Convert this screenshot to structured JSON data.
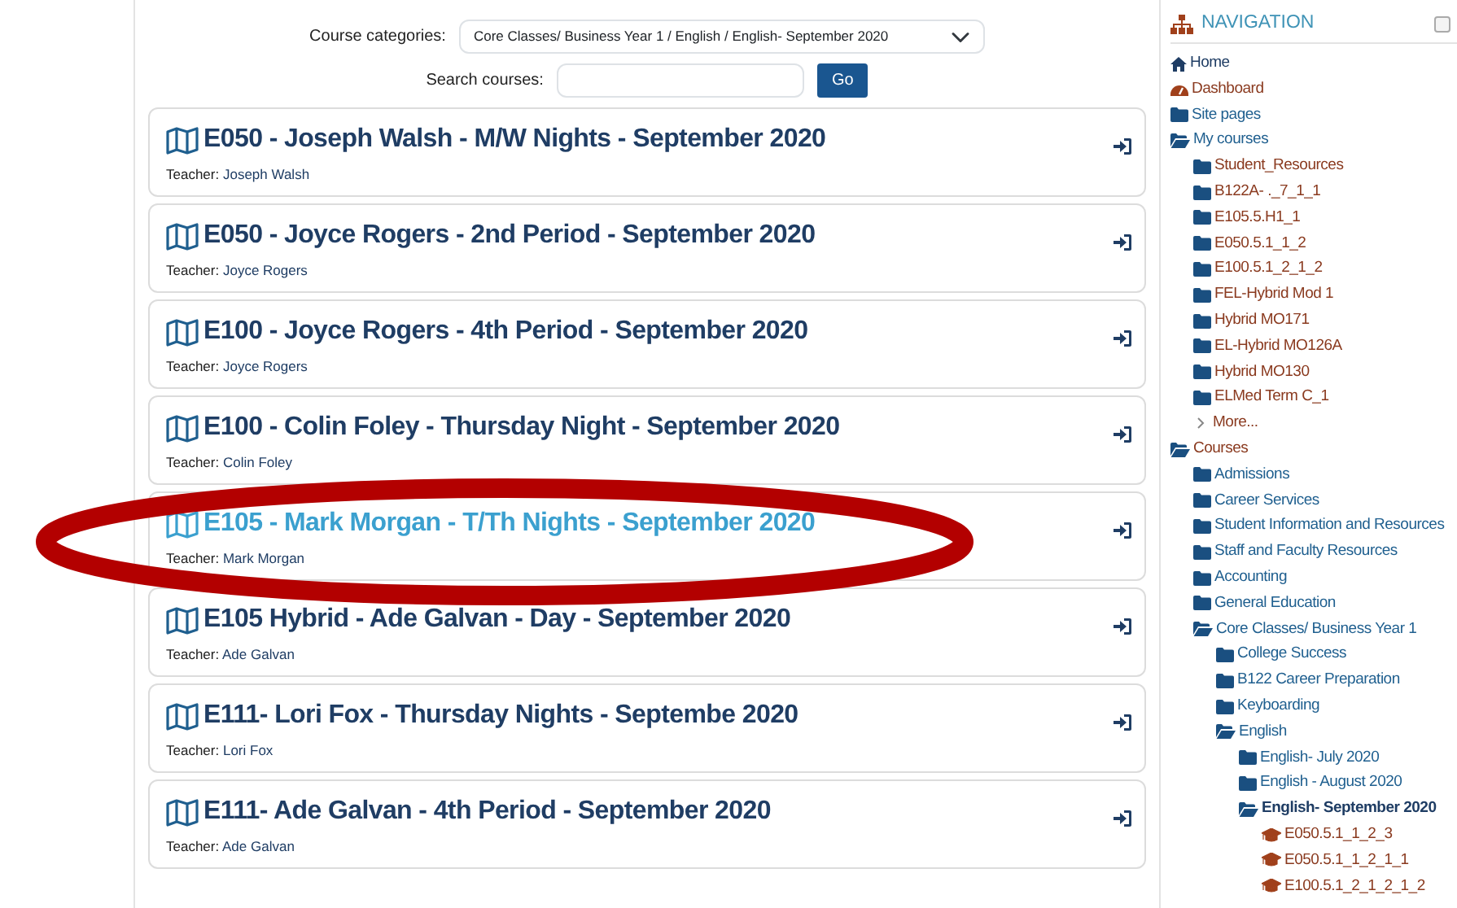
{
  "filters": {
    "category_label": "Course categories:",
    "category_value": "Core Classes/ Business Year 1 / English / English- September 2020",
    "search_label": "Search courses:",
    "search_button": "Go"
  },
  "courses": [
    {
      "title": "E050 - Joseph Walsh - M/W Nights - September 2020",
      "teacher_label": "Teacher:",
      "teacher": "Joseph Walsh",
      "highlighted": false
    },
    {
      "title": "E050 - Joyce Rogers - 2nd Period - September 2020",
      "teacher_label": "Teacher:",
      "teacher": "Joyce Rogers",
      "highlighted": false
    },
    {
      "title": "E100 - Joyce Rogers - 4th Period - September 2020",
      "teacher_label": "Teacher:",
      "teacher": "Joyce Rogers",
      "highlighted": false
    },
    {
      "title": "E100 - Colin Foley - Thursday Night - September 2020",
      "teacher_label": "Teacher:",
      "teacher": "Colin Foley",
      "highlighted": false
    },
    {
      "title": "E105 - Mark Morgan - T/Th Nights - September 2020",
      "teacher_label": "Teacher:",
      "teacher": "Mark Morgan",
      "highlighted": true
    },
    {
      "title": "E105 Hybrid - Ade Galvan - Day - September 2020",
      "teacher_label": "Teacher:",
      "teacher": "Ade Galvan",
      "highlighted": false
    },
    {
      "title": "E111- Lori Fox - Thursday Nights - Septembe 2020",
      "teacher_label": "Teacher:",
      "teacher": "Lori Fox",
      "highlighted": false
    },
    {
      "title": "E111- Ade Galvan - 4th Period - September 2020",
      "teacher_label": "Teacher:",
      "teacher": "Ade Galvan",
      "highlighted": false
    }
  ],
  "annotation": {
    "kind": "ellipse",
    "color": "#b30000"
  },
  "navigation": {
    "title": "NAVIGATION",
    "items": [
      {
        "label": "Home",
        "kind": "home",
        "color": "#1f3d64"
      },
      {
        "label": "Dashboard",
        "kind": "dashboard",
        "color": "#8a3a1f"
      },
      {
        "label": "Site pages",
        "kind": "folder",
        "color": "#1f5f8f"
      },
      {
        "label": "My courses",
        "kind": "folder-open",
        "color": "#1f5f8f",
        "children": [
          {
            "label": "Student_Resources",
            "kind": "folder",
            "color": "#8a3a1f"
          },
          {
            "label": "B122A- ._7_1_1",
            "kind": "folder",
            "color": "#8a3a1f"
          },
          {
            "label": "E105.5.H1_1",
            "kind": "folder",
            "color": "#8a3a1f"
          },
          {
            "label": "E050.5.1_1_2",
            "kind": "folder",
            "color": "#8a3a1f"
          },
          {
            "label": "E100.5.1_2_1_2",
            "kind": "folder",
            "color": "#8a3a1f"
          },
          {
            "label": "FEL-Hybrid Mod 1",
            "kind": "folder",
            "color": "#8a3a1f"
          },
          {
            "label": "Hybrid MO171",
            "kind": "folder",
            "color": "#8a3a1f"
          },
          {
            "label": "EL-Hybrid MO126A",
            "kind": "folder",
            "color": "#8a3a1f"
          },
          {
            "label": "Hybrid MO130",
            "kind": "folder",
            "color": "#8a3a1f"
          },
          {
            "label": "ELMed Term C_1",
            "kind": "folder",
            "color": "#8a3a1f"
          },
          {
            "label": "More...",
            "kind": "more",
            "color": "#8a3a1f"
          }
        ]
      },
      {
        "label": "Courses",
        "kind": "folder-open",
        "color": "#8a3a1f",
        "children": [
          {
            "label": "Admissions",
            "kind": "folder",
            "color": "#1f5f8f"
          },
          {
            "label": "Career Services",
            "kind": "folder",
            "color": "#1f5f8f"
          },
          {
            "label": "Student Information and Resources",
            "kind": "folder",
            "color": "#1f5f8f"
          },
          {
            "label": "Staff and Faculty Resources",
            "kind": "folder",
            "color": "#1f5f8f"
          },
          {
            "label": "Accounting",
            "kind": "folder",
            "color": "#1f5f8f"
          },
          {
            "label": "General Education",
            "kind": "folder",
            "color": "#1f5f8f"
          },
          {
            "label": "Core Classes/ Business Year 1",
            "kind": "folder-open",
            "color": "#1f5f8f",
            "children": [
              {
                "label": "College Success",
                "kind": "folder",
                "color": "#1f5f8f"
              },
              {
                "label": "B122 Career Preparation",
                "kind": "folder",
                "color": "#1f5f8f"
              },
              {
                "label": "Keyboarding",
                "kind": "folder",
                "color": "#1f5f8f"
              },
              {
                "label": "English",
                "kind": "folder-open",
                "color": "#1f5f8f",
                "children": [
                  {
                    "label": "English- July 2020",
                    "kind": "folder",
                    "color": "#1f5f8f"
                  },
                  {
                    "label": "English - August 2020",
                    "kind": "folder",
                    "color": "#1f5f8f"
                  },
                  {
                    "label": "English- September 2020",
                    "kind": "current",
                    "color": "#1f3d64",
                    "children": [
                      {
                        "label": "E050.5.1_1_2_3",
                        "kind": "course",
                        "color": "#8a3a1f"
                      },
                      {
                        "label": "E050.5.1_1_2_1_1",
                        "kind": "course",
                        "color": "#8a3a1f"
                      },
                      {
                        "label": "E100.5.1_2_1_2_1_2",
                        "kind": "course",
                        "color": "#8a3a1f"
                      }
                    ]
                  }
                ]
              }
            ]
          }
        ]
      }
    ]
  }
}
